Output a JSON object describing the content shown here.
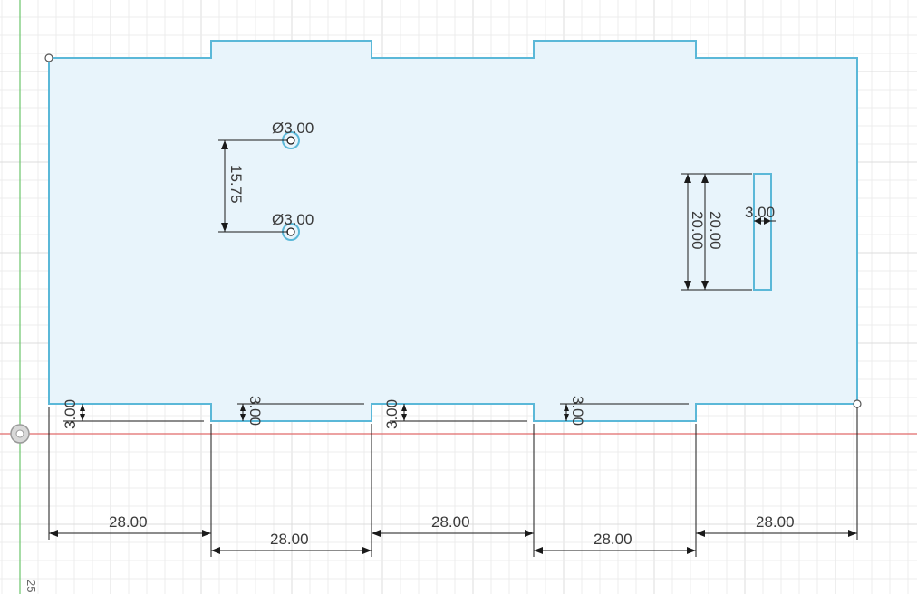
{
  "sketch": {
    "colors": {
      "profile_fill": "#e8f4fb",
      "profile_stroke": "#5bb8d8",
      "dimension": "#1a1a1a",
      "grid_minor": "#ececec",
      "grid_major": "#dcdcdc",
      "axis_x": "#e06b6b",
      "axis_y": "#6cc46c",
      "hole_stroke": "#5bb8d8"
    },
    "dimensions": {
      "hole_diameter_top": "Ø3.00",
      "hole_diameter_bottom": "Ø3.00",
      "hole_spacing": "15.75",
      "slot_height_outer": "20.00",
      "slot_height_inner": "20.00",
      "slot_width": "3.00",
      "notch_depth_1": "3.00",
      "notch_depth_2": "3.00",
      "notch_depth_3": "3.00",
      "notch_depth_4": "3.00",
      "segment_1": "28.00",
      "segment_2": "28.00",
      "segment_3": "28.00",
      "segment_4": "28.00",
      "segment_5": "28.00"
    },
    "edge_label": "25"
  }
}
